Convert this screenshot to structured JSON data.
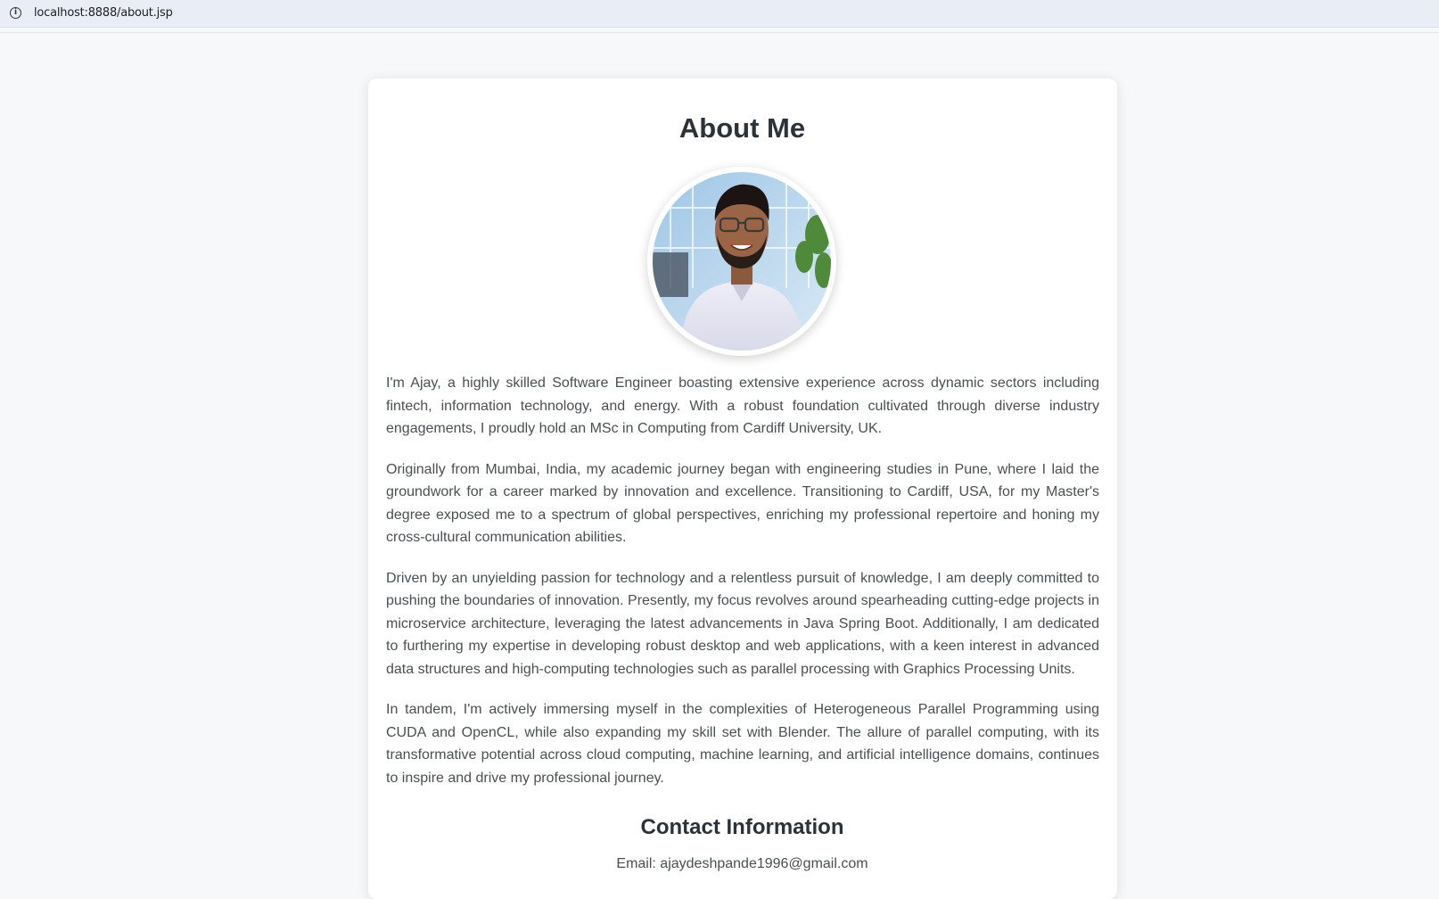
{
  "browser": {
    "url": "localhost:8888/about.jsp",
    "info_icon": "info-icon"
  },
  "page": {
    "title": "About Me",
    "profile_photo": "profile-photo",
    "paragraphs": [
      "I'm Ajay, a highly skilled Software Engineer boasting extensive experience across dynamic sectors including fintech, information technology, and energy. With a robust foundation cultivated through diverse industry engagements, I proudly hold an MSc in Computing from Cardiff University, UK.",
      "Originally from Mumbai, India, my academic journey began with engineering studies in Pune, where I laid the groundwork for a career marked by innovation and excellence. Transitioning to Cardiff, USA, for my Master's degree exposed me to a spectrum of global perspectives, enriching my professional repertoire and honing my cross-cultural communication abilities.",
      "Driven by an unyielding passion for technology and a relentless pursuit of knowledge, I am deeply committed to pushing the boundaries of innovation. Presently, my focus revolves around spearheading cutting-edge projects in microservice architecture, leveraging the latest advancements in Java Spring Boot. Additionally, I am dedicated to furthering my expertise in developing robust desktop and web applications, with a keen interest in advanced data structures and high-computing technologies such as parallel processing with Graphics Processing Units.",
      "In tandem, I'm actively immersing myself in the complexities of Heterogeneous Parallel Programming using CUDA and OpenCL, while also expanding my skill set with Blender. The allure of parallel computing, with its transformative potential across cloud computing, machine learning, and artificial intelligence domains, continues to inspire and drive my professional journey."
    ],
    "contact": {
      "heading": "Contact Information",
      "email": "Email: ajaydeshpande1996@gmail.com"
    }
  },
  "colors": {
    "background": "#f7f8f9",
    "card": "#ffffff",
    "heading": "#2c3338",
    "body_text": "#4a4f54"
  }
}
